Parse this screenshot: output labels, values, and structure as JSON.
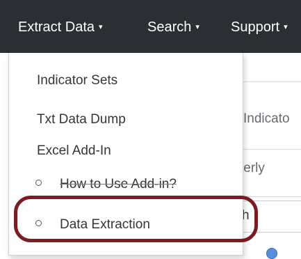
{
  "navbar": {
    "items": [
      {
        "label": "Extract Data",
        "caret": "▾"
      },
      {
        "label": "Search",
        "caret": "▾"
      },
      {
        "label": "Support",
        "caret": "▾"
      }
    ]
  },
  "background": {
    "fragments": [
      "Indicato",
      "terly",
      "h"
    ]
  },
  "dropdown": {
    "items": [
      "Indicator Sets",
      "Txt Data Dump",
      "Excel Add-In"
    ],
    "subitems": [
      "How to Use Add-in?",
      "Data Extraction"
    ]
  },
  "colors": {
    "navbar": "#2b2f34",
    "highlight": "#7a1c24"
  }
}
